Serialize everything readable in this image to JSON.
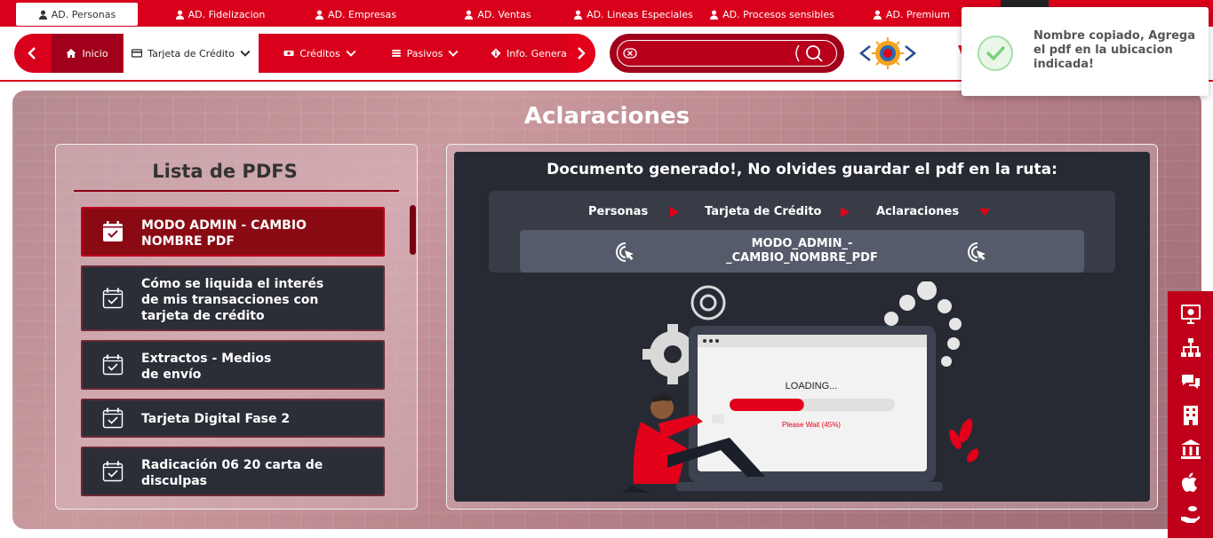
{
  "top_tabs": [
    {
      "label": "AD. Personas",
      "active": true
    },
    {
      "label": "AD. Fidelizacion",
      "active": false
    },
    {
      "label": "AD. Empresas",
      "active": false
    },
    {
      "label": "AD. Ventas",
      "active": false
    },
    {
      "label": "AD. Lineas Especiales",
      "active": false
    },
    {
      "label": "AD. Procesos sensibles",
      "active": false
    },
    {
      "label": "AD. Premium",
      "active": false
    }
  ],
  "nav": {
    "inicio": "Inicio",
    "tarjeta": "Tarjeta de Crédito",
    "creditos": "Créditos",
    "pasivos": "Pasivos",
    "info": "Info. General"
  },
  "search": {
    "value": "",
    "placeholder": ""
  },
  "brand": {
    "partial_letter": "V"
  },
  "toast": {
    "message": "Nombre copiado, Agrega el pdf en la ubicacion indicada!"
  },
  "page": {
    "title": "Aclaraciones"
  },
  "left_panel": {
    "title": "Lista de PDFS",
    "items": [
      {
        "label": "MODO ADMIN - CAMBIO\nNOMBRE PDF",
        "active": true
      },
      {
        "label": "Cómo se liquida el interés\nde mis transacciones con\ntarjeta de crédito",
        "active": false
      },
      {
        "label": "Extractos - Medios\nde envío",
        "active": false
      },
      {
        "label": "Tarjeta Digital Fase 2",
        "active": false
      },
      {
        "label": "Radicación 06 20 carta de\ndisculpas",
        "active": false
      }
    ]
  },
  "right_panel": {
    "title": "Documento generado!, No olvides guardar el pdf en la ruta:",
    "route": [
      "Personas",
      "Tarjeta de Crédito",
      "Aclaraciones"
    ],
    "filename": "MODO_ADMIN_-\n_CAMBIO_NOMBRE_PDF",
    "illustration": {
      "loading_text": "LOADING...",
      "wait_text": "Please Wait (45%)",
      "progress": 0.45
    }
  },
  "sidebar_icons": [
    "presentation-icon",
    "org-chart-icon",
    "chat-icon",
    "building-icon",
    "bank-icon",
    "apple-icon",
    "hand-coins-icon"
  ],
  "colors": {
    "primary": "#d9001b",
    "dark": "#272a33",
    "accent": "#e2001a"
  }
}
